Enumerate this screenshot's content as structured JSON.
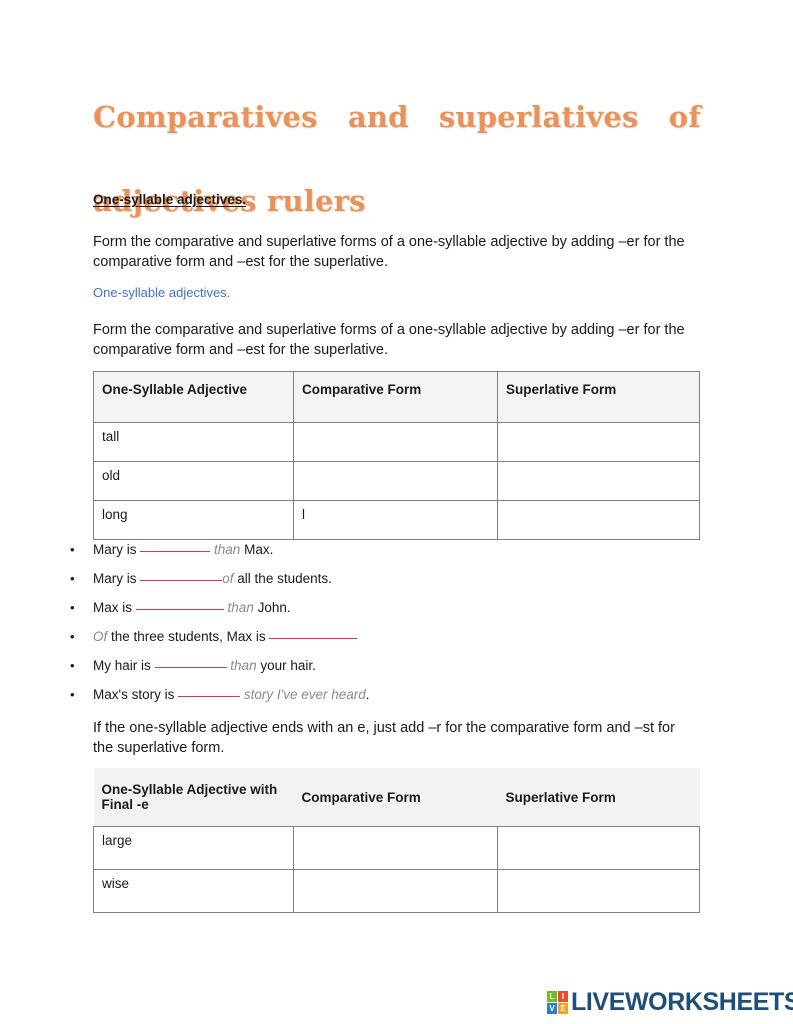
{
  "document": {
    "title_line1": "Comparatives and superlatives of",
    "title_line2": "adjectives rulers",
    "title_color": "#E8935C"
  },
  "section_one": {
    "heading_underlined": "One-syllable adjectives.",
    "paragraph_1": "Form the comparative and superlative forms of a one-syllable adjective by adding –er for the comparative form and –est for the superlative.",
    "heading_blue": "One-syllable adjectives.",
    "heading_blue_color": "#4472C4",
    "paragraph_2": "Form the comparative and superlative forms of a one-syllable adjective by adding –er for the comparative form and –est for the superlative."
  },
  "table_one": {
    "headers": [
      "One-Syllable Adjective",
      "Comparative Form",
      "Superlative Form"
    ],
    "rows": [
      {
        "adjective": "tall",
        "comparative": "",
        "superlative": ""
      },
      {
        "adjective": "old",
        "comparative": "",
        "superlative": ""
      },
      {
        "adjective": "long",
        "comparative": "l",
        "superlative": ""
      }
    ]
  },
  "exercises": {
    "blank_color": "#D6336C",
    "items": [
      {
        "pre": "Mary is",
        "blank_width": 70,
        "mid": "than",
        "mid_style": "italic-gray",
        "post": "Max."
      },
      {
        "pre": "Mary is",
        "blank_width": 82,
        "mid": "of",
        "mid_style": "italic-gray",
        "post": "all the students."
      },
      {
        "pre": "Max is",
        "blank_width": 88,
        "mid": "than",
        "mid_style": "italic-gray",
        "post": "John."
      },
      {
        "pre_italic": "Of",
        "pre": "the three students, Max is",
        "blank_width": 88,
        "mid": "",
        "post": ""
      },
      {
        "pre": "My hair is",
        "blank_width": 72,
        "mid": "than",
        "mid_style": "italic-gray",
        "post": "your hair."
      },
      {
        "pre": "Max's story is",
        "blank_width": 62,
        "mid": "story I've ever heard",
        "mid_style": "italic-gray",
        "post": "."
      }
    ]
  },
  "section_two": {
    "paragraph": "If the one-syllable adjective ends with an e, just add –r for the comparative form and –st for the superlative form."
  },
  "table_two": {
    "headers": [
      "One-Syllable Adjective with Final -e",
      "Comparative Form",
      "Superlative Form"
    ],
    "header_line1": "One-Syllable Adjective with",
    "header_line2": "Final -e",
    "rows": [
      {
        "adjective": "large",
        "comparative": "",
        "superlative": ""
      },
      {
        "adjective": "wise",
        "comparative": "",
        "superlative": ""
      }
    ]
  },
  "footer": {
    "logo_tiles": [
      "L",
      "I",
      "V",
      "E"
    ],
    "logo_text": "LIVEWORKSHEETS",
    "logo_text_color": "#1F4E79"
  }
}
